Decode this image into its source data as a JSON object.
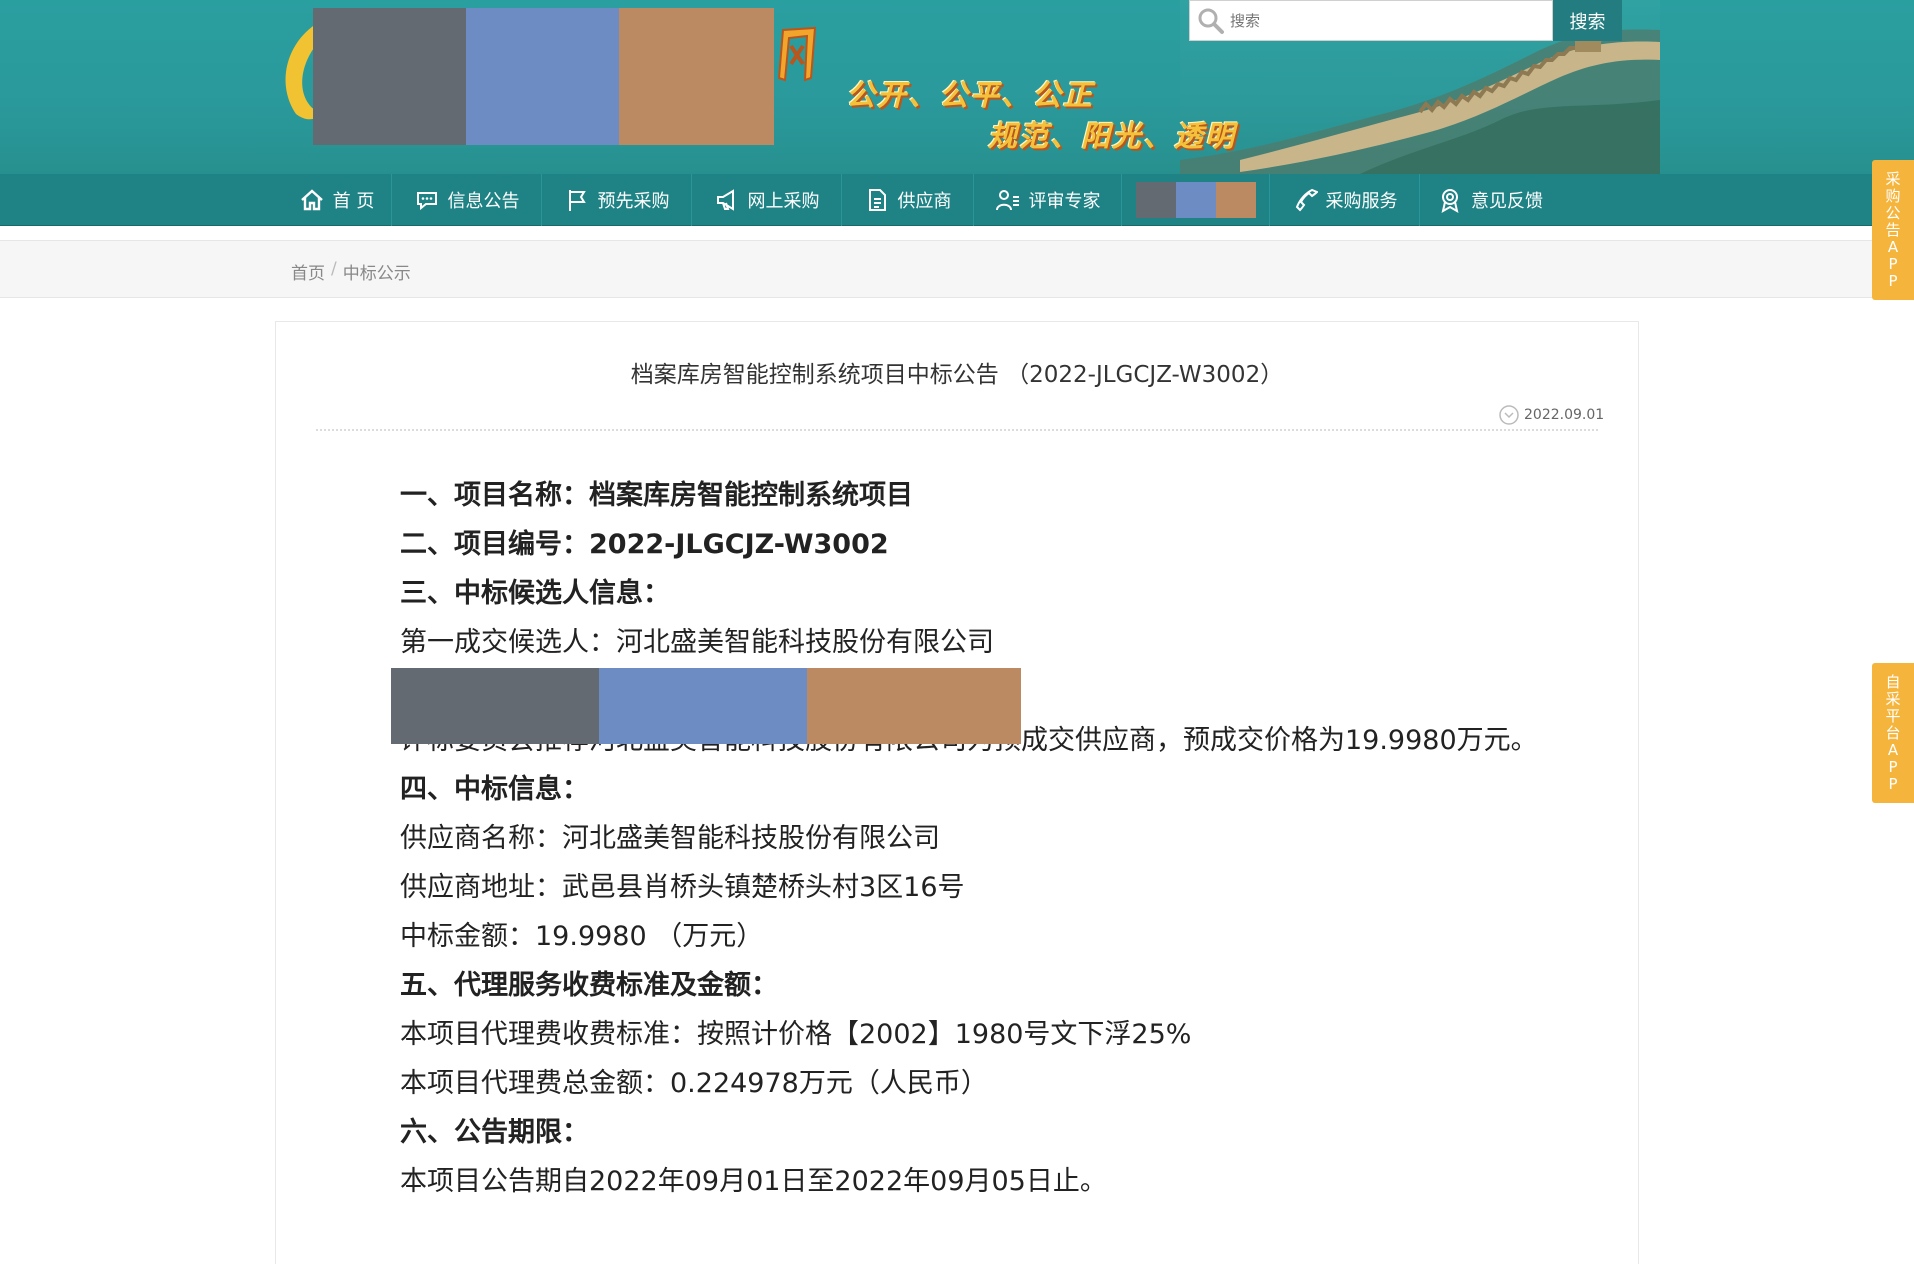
{
  "header": {
    "slogan_line1": "公开、公平、公正",
    "slogan_line2": "规范、阳光、透明",
    "search_placeholder": "搜索",
    "search_button": "搜索",
    "colors": {
      "banner": "#2a9fa0",
      "nav": "#1f8386",
      "search_button": "#237d80",
      "slogan": "#f4c13a"
    },
    "redaction_colors": [
      "#636a72",
      "#6d8cc4",
      "#bc8a62"
    ]
  },
  "nav": {
    "items": [
      {
        "label": "首 页",
        "icon": "home-icon"
      },
      {
        "label": "信息公告",
        "icon": "chat-icon"
      },
      {
        "label": "预先采购",
        "icon": "flag-icon"
      },
      {
        "label": "网上采购",
        "icon": "megaphone-icon"
      },
      {
        "label": "供应商",
        "icon": "document-icon"
      },
      {
        "label": "评审专家",
        "icon": "expert-icon"
      },
      {
        "label": "采购服务",
        "icon": "phone-icon"
      },
      {
        "label": "意见反馈",
        "icon": "award-icon"
      }
    ]
  },
  "breadcrumb": {
    "home": "首页",
    "separator": "/",
    "current": "中标公示"
  },
  "side_tabs": {
    "top": [
      "采",
      "购",
      "公",
      "告",
      "A",
      "P",
      "P"
    ],
    "bottom": [
      "自",
      "采",
      "平",
      "台",
      "A",
      "P",
      "P"
    ],
    "color": "#f5b43c"
  },
  "article": {
    "title": "档案库房智能控制系统项目中标公告 （2022-JLGCJZ-W3002）",
    "date": "2022.09.01",
    "lines": {
      "l1": "一、项目名称：档案库房智能控制系统项目",
      "l2": "二、项目编号：2022-JLGCJZ-W3002",
      "l3": "三、中标候选人信息：",
      "l4": "第一成交候选人：河北盛美智能科技股份有限公司",
      "l6": "评标委员会推荐河北盛美智能科技股份有限公司为预成交供应商，预成交价格为19.9980万元。",
      "l7": "四、中标信息：",
      "l8": "供应商名称：河北盛美智能科技股份有限公司",
      "l9": "供应商地址：武邑县肖桥头镇楚桥头村3区16号",
      "l10": "中标金额：19.9980 （万元）",
      "l11": "五、代理服务收费标准及金额：",
      "l12": "本项目代理费收费标准：按照计价格【2002】1980号文下浮25%",
      "l13": "本项目代理费总金额：0.224978万元（人民币）",
      "l14": "六、公告期限：",
      "l15": "本项目公告期自2022年09月01日至2022年09月05日止。"
    }
  }
}
